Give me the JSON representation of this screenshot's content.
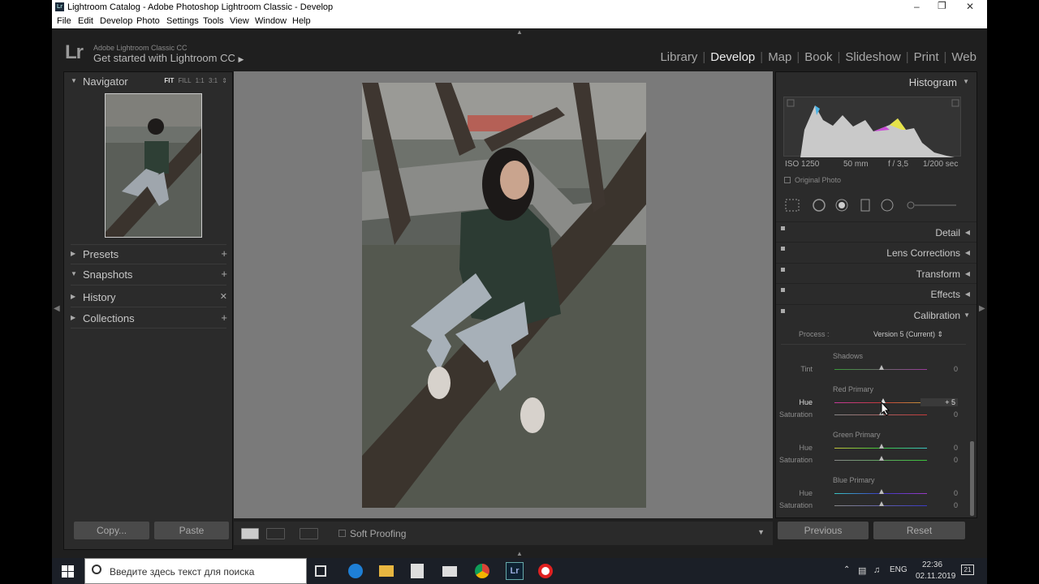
{
  "window": {
    "title": "Lightroom Catalog - Adobe Photoshop Lightroom Classic - Develop"
  },
  "menu": [
    "File",
    "Edit",
    "Develop",
    "Photo",
    "Settings",
    "Tools",
    "View",
    "Window",
    "Help"
  ],
  "identity": {
    "logo": "Lr",
    "product": "Adobe Lightroom Classic CC",
    "tagline": "Get started with Lightroom CC"
  },
  "modules": {
    "library": "Library",
    "develop": "Develop",
    "map": "Map",
    "book": "Book",
    "slideshow": "Slideshow",
    "print": "Print",
    "web": "Web"
  },
  "left_panel": {
    "navigator": {
      "title": "Navigator",
      "fit": "FIT",
      "fill": "FILL",
      "one": "1:1",
      "three": "3:1"
    },
    "presets": "Presets",
    "snapshots": "Snapshots",
    "history": "History",
    "collections": "Collections",
    "copy_button": "Copy...",
    "paste_button": "Paste"
  },
  "toolbar": {
    "soft_proofing": "Soft Proofing"
  },
  "histogram": {
    "title": "Histogram",
    "iso": "ISO 1250",
    "focal": "50 mm",
    "aperture": "f / 3,5",
    "shutter": "1/200 sec",
    "original_photo": "Original Photo"
  },
  "sections": {
    "detail": "Detail",
    "lens": "Lens Corrections",
    "transform": "Transform",
    "effects": "Effects",
    "calibration": "Calibration"
  },
  "calibration": {
    "process_label": "Process :",
    "process_value": "Version 5 (Current)",
    "shadows": {
      "heading": "Shadows",
      "tint_label": "Tint",
      "tint_value": "0"
    },
    "red": {
      "heading": "Red Primary",
      "hue_label": "Hue",
      "hue_value": "+ 5",
      "sat_label": "Saturation",
      "sat_value": "0"
    },
    "green": {
      "heading": "Green Primary",
      "hue_label": "Hue",
      "hue_value": "0",
      "sat_label": "Saturation",
      "sat_value": "0"
    },
    "blue": {
      "heading": "Blue Primary",
      "hue_label": "Hue",
      "hue_value": "0",
      "sat_label": "Saturation",
      "sat_value": "0"
    }
  },
  "right_bottom": {
    "previous": "Previous",
    "reset": "Reset"
  },
  "taskbar": {
    "search_placeholder": "Введите здесь текст для поиска",
    "lang": "ENG",
    "time": "22:36",
    "date": "02.11.2019",
    "notifications": "21"
  }
}
